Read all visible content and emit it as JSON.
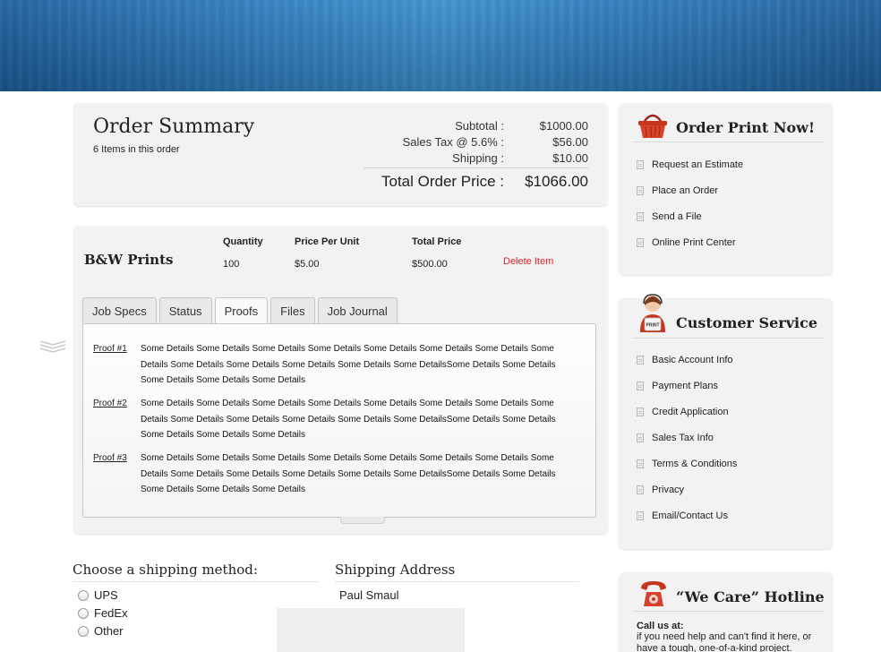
{
  "summary": {
    "title": "Order Summary",
    "items_count": "6 Items in this order",
    "subtotal_label": "Subtotal :",
    "subtotal_value": "$1000.00",
    "tax_label": "Sales Tax @ 5.6% :",
    "tax_value": "$56.00",
    "shipping_label": "Shipping :",
    "shipping_value": "$10.00",
    "total_label": "Total Order Price :",
    "total_value": "$1066.00"
  },
  "item": {
    "name": "B&W Prints",
    "quantity_header": "Quantity",
    "quantity_value": "100",
    "ppu_header": "Price Per Unit",
    "ppu_value": "$5.00",
    "total_header": "Total Price",
    "total_value": "$500.00",
    "delete_label": "Delete Item"
  },
  "tabs": [
    {
      "label": "Job Specs",
      "active": false
    },
    {
      "label": "Status",
      "active": false
    },
    {
      "label": "Proofs",
      "active": true
    },
    {
      "label": "Files",
      "active": false
    },
    {
      "label": "Job Journal",
      "active": false
    }
  ],
  "proofs": [
    {
      "link": "Proof #1",
      "details": "Some Details Some Details Some Details Some Details Some Details Some Details Some Details Some Details Some Details Some Details Some Details Some Details Some DetailsSome Details Some Details Some Details Some Details Some Details"
    },
    {
      "link": "Proof #2",
      "details": "Some Details Some Details Some Details Some Details Some Details Some Details Some Details Some Details Some Details Some Details Some Details Some Details Some DetailsSome Details Some Details Some Details Some Details Some Details"
    },
    {
      "link": "Proof #3",
      "details": "Some Details Some Details Some Details Some Details Some Details Some Details Some Details Some Details Some Details Some Details Some Details Some Details Some DetailsSome Details Some Details Some Details Some Details Some Details"
    }
  ],
  "shipping": {
    "method_title": "Choose a shipping method:",
    "options": [
      "UPS",
      "FedEx",
      "Other"
    ],
    "address_title": "Shipping Address",
    "address_name": "Paul Smaul"
  },
  "order_print": {
    "title": "Order Print Now!",
    "links": [
      "Request an Estimate",
      "Place an Order",
      "Send a File",
      "Online Print Center"
    ]
  },
  "customer_service": {
    "title": "Customer Service",
    "icon_badge": "PRINT",
    "links": [
      "Basic Account Info",
      "Payment Plans",
      "Credit Application",
      "Sales Tax Info",
      "Terms & Conditions",
      "Privacy",
      "Email/Contact Us"
    ]
  },
  "hotline": {
    "title": "“We Care” Hotline",
    "call_us": "Call us at:",
    "help_text": "if you need help and can't find it here, or have a tough, one-of-a-kind project."
  },
  "colors": {
    "banner_blue": "#2f7fc0",
    "delete_red": "#d8232a",
    "panel_gray": "#f2f2f2"
  }
}
